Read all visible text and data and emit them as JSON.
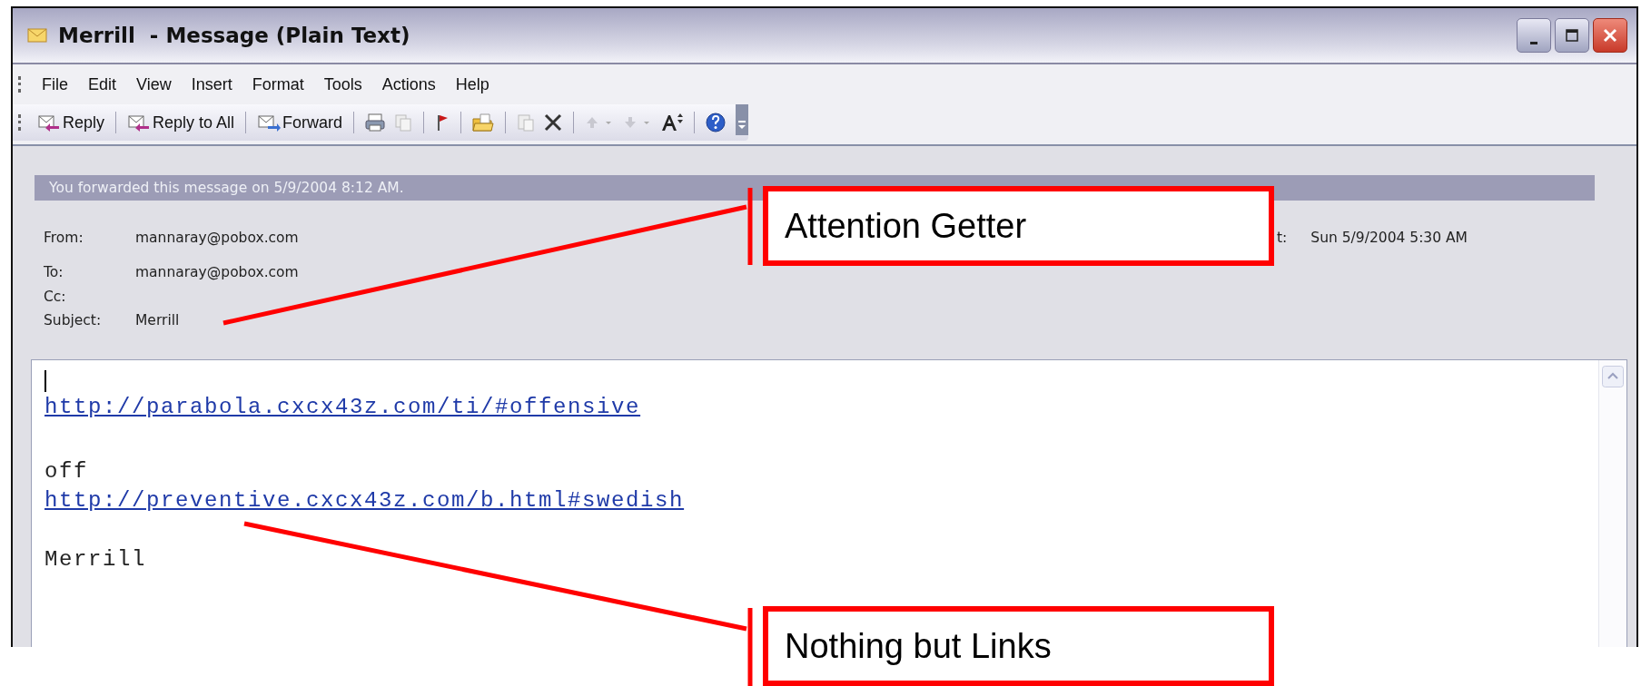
{
  "window": {
    "title": "Merrill  - Message (Plain Text)"
  },
  "menu": [
    {
      "label": "File"
    },
    {
      "label": "Edit"
    },
    {
      "label": "View"
    },
    {
      "label": "Insert"
    },
    {
      "label": "Format"
    },
    {
      "label": "Tools"
    },
    {
      "label": "Actions"
    },
    {
      "label": "Help"
    }
  ],
  "toolbar": {
    "buttons": [
      {
        "label": "Reply"
      },
      {
        "label": "Reply to All"
      },
      {
        "label": "Forward"
      }
    ]
  },
  "info_bar": "You forwarded this message on 5/9/2004 8:12 AM.",
  "header": {
    "fields": [
      {
        "label": "From:",
        "value": "mannaray@pobox.com"
      },
      {
        "label": "To:",
        "value": "mannaray@pobox.com"
      },
      {
        "label": "Cc:"
      },
      {
        "label": "Subject:",
        "value": "Merrill"
      }
    ],
    "sent": {
      "label": "t:",
      "value": "Sun 5/9/2004 5:30 AM"
    }
  },
  "body": {
    "lines": [
      {
        "kind": "cursor"
      },
      {
        "kind": "link",
        "text": "http://parabola.cxcx43z.com/ti/#offensive"
      },
      {
        "kind": "blank"
      },
      {
        "kind": "text",
        "text": "off"
      },
      {
        "kind": "link",
        "text": "http://preventive.cxcx43z.com/b.html#swedish"
      },
      {
        "kind": "blank"
      },
      {
        "kind": "text",
        "text": "Merrill"
      }
    ]
  },
  "callouts": [
    {
      "text": "Attention Getter"
    },
    {
      "text": "Nothing but Links"
    }
  ]
}
